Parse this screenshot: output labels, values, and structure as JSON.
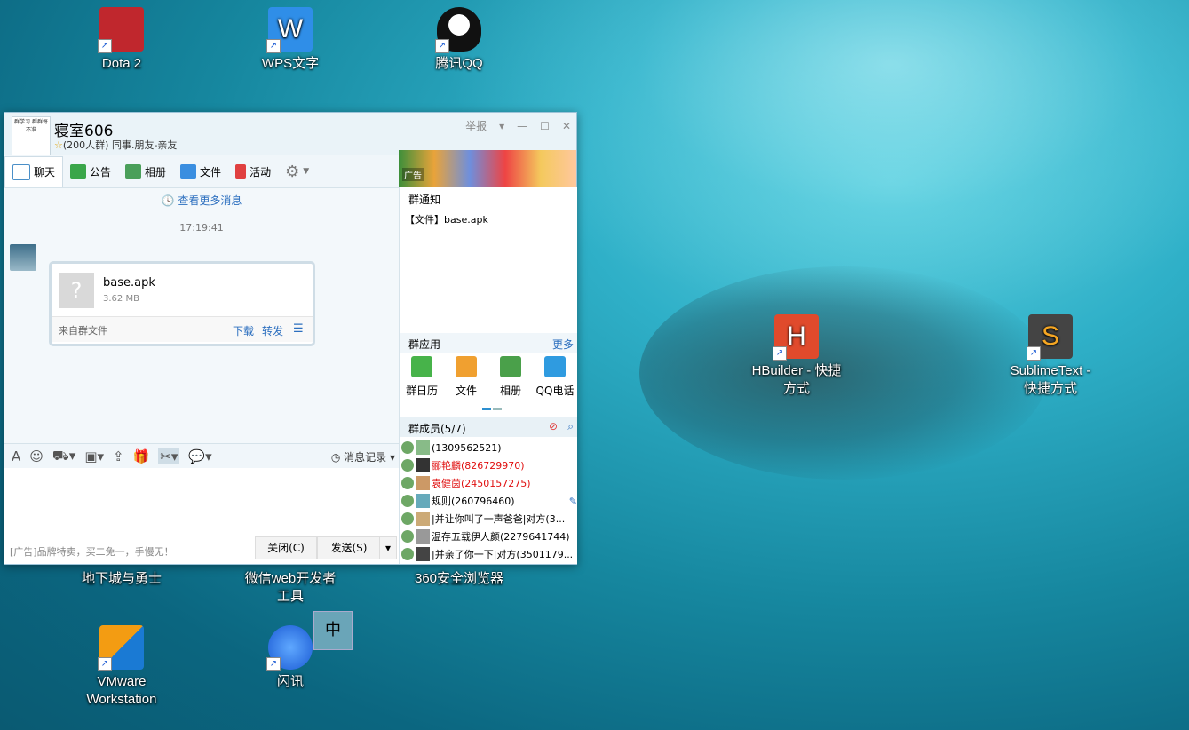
{
  "desktop": {
    "icons": [
      {
        "label": "Dota 2",
        "color": "#c0272d"
      },
      {
        "label": "WPS文字",
        "color": "#2f8ee8"
      },
      {
        "label": "腾讯QQ",
        "color": "#111111"
      },
      {
        "label": "HBuilder - 快捷方式",
        "color": "#e04a2c"
      },
      {
        "label": "SublimeText - 快捷方式",
        "color": "#444444"
      },
      {
        "label": "地下城与勇士",
        "color": "#333333"
      },
      {
        "label": "微信web开发者工具",
        "color": "#333333"
      },
      {
        "label": "360安全浏览器",
        "color": "#333333"
      },
      {
        "label": "VMware Workstation",
        "color": "#1a7ad4"
      },
      {
        "label": "闪讯",
        "color": "#1a5ad4"
      }
    ],
    "ime_label": "中"
  },
  "qq_window": {
    "group_name": "寝室606",
    "group_avatar_text": "群学习 群群每不准",
    "group_sub": "(200人群) 同事.朋友-亲友",
    "report_label": "举报",
    "tabs": [
      {
        "label": "聊天",
        "icon": "chat-icon"
      },
      {
        "label": "公告",
        "icon": "flag-icon"
      },
      {
        "label": "相册",
        "icon": "photo-icon"
      },
      {
        "label": "文件",
        "icon": "folder-icon"
      },
      {
        "label": "活动",
        "icon": "flag-red-icon"
      }
    ],
    "ad_label": "广告",
    "chat": {
      "more_messages": "查看更多消息",
      "timestamp": "17:19:41",
      "file": {
        "name": "base.apk",
        "size": "3.62 MB",
        "from": "来自群文件",
        "download": "下载",
        "forward": "转发"
      }
    },
    "toolbar": {
      "history_label": "消息记录"
    },
    "bottom": {
      "ad_text": "[广告]品牌特卖，买二免一，手慢无！",
      "close_label": "关闭(C)",
      "send_label": "发送(S)"
    },
    "side": {
      "notice_title": "群通知",
      "notice_item": "【文件】base.apk",
      "apps_title": "群应用",
      "apps_more": "更多",
      "apps": [
        {
          "label": "群日历",
          "color": "#47b34a"
        },
        {
          "label": "文件",
          "color": "#f0a030"
        },
        {
          "label": "相册",
          "color": "#4aa04a"
        },
        {
          "label": "QQ电话",
          "color": "#2f9be0"
        }
      ],
      "members_title": "群成员(5/7)",
      "members": [
        {
          "name": "(1309562521)",
          "color": "#000000"
        },
        {
          "name": "郦艳麟(826729970)",
          "color": "#e01010"
        },
        {
          "name": "袁健茵(2450157275)",
          "color": "#e01010"
        },
        {
          "name": "规则(260796460)",
          "color": "#000000"
        },
        {
          "name": "|并让你叫了一声爸爸|对方(3...",
          "color": "#000000"
        },
        {
          "name": "温存五载伊人颜(2279641744)",
          "color": "#000000"
        },
        {
          "name": "|并亲了你一下|对方(3501179...",
          "color": "#000000"
        }
      ]
    }
  }
}
